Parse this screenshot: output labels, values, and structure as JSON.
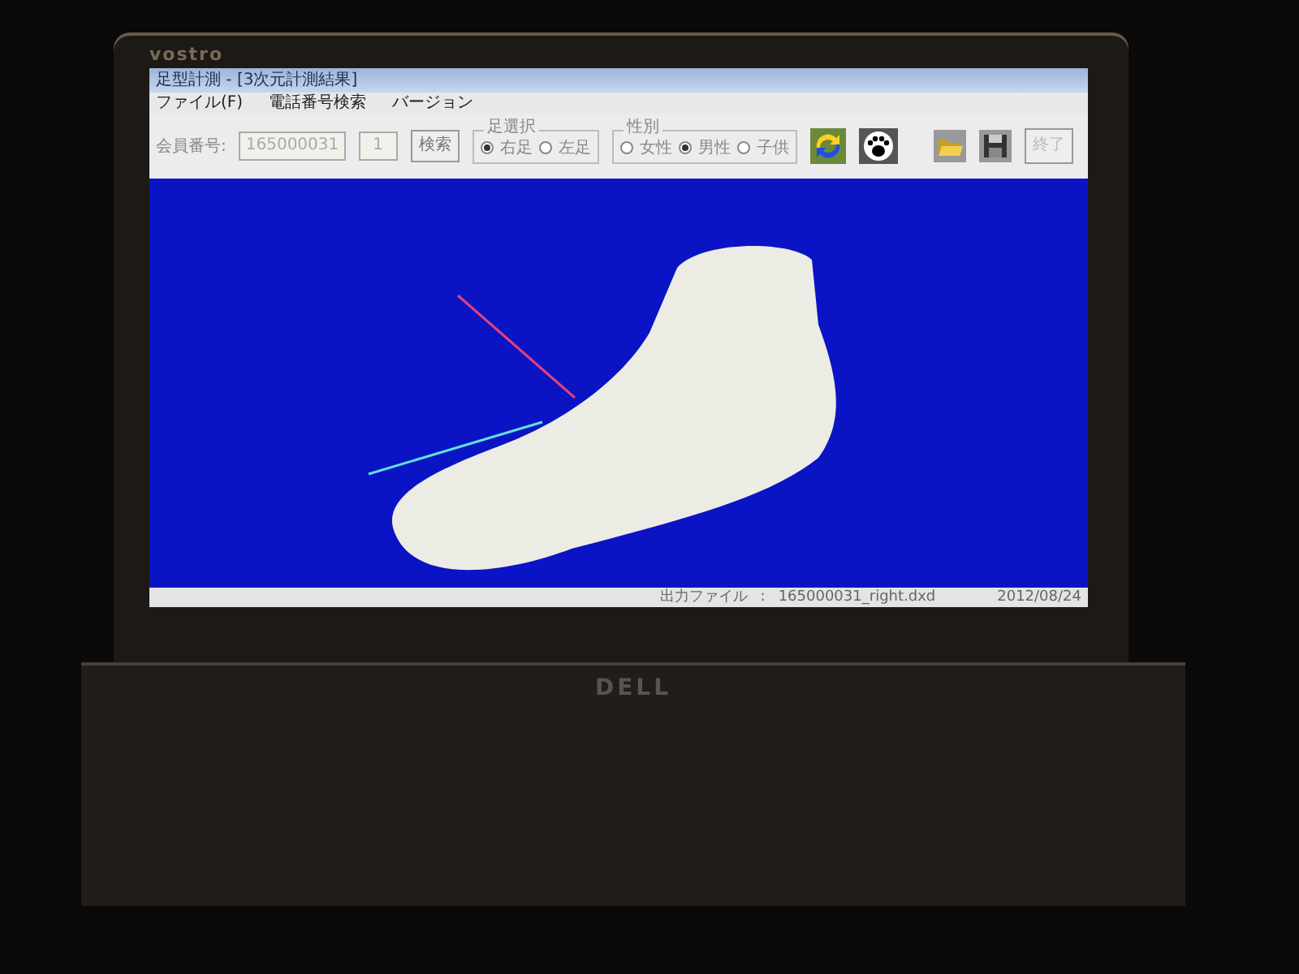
{
  "laptop": {
    "logo": "vostro",
    "brand": "DELL"
  },
  "window": {
    "title": "足型計測 - [3次元計測結果]"
  },
  "menu": [
    "ファイル(F)",
    "電話番号検索",
    "バージョン"
  ],
  "toolbar": {
    "member_label": "会員番号:",
    "member_id": "165000031",
    "count": "1",
    "search_button": "検索",
    "foot_group": {
      "label": "足選択",
      "options": [
        {
          "label": "右足",
          "selected": true
        },
        {
          "label": "左足",
          "selected": false
        }
      ]
    },
    "sex_group": {
      "label": "性別",
      "options": [
        {
          "label": "女性",
          "selected": false
        },
        {
          "label": "男性",
          "selected": true
        },
        {
          "label": "子供",
          "selected": false
        }
      ]
    },
    "exit_button": {
      "label": "終了",
      "disabled": true
    }
  },
  "status_bar": {
    "output_label": "出力ファイル",
    "separator": ":",
    "file": "165000031_right.dxd",
    "date": "2012/08/24"
  }
}
